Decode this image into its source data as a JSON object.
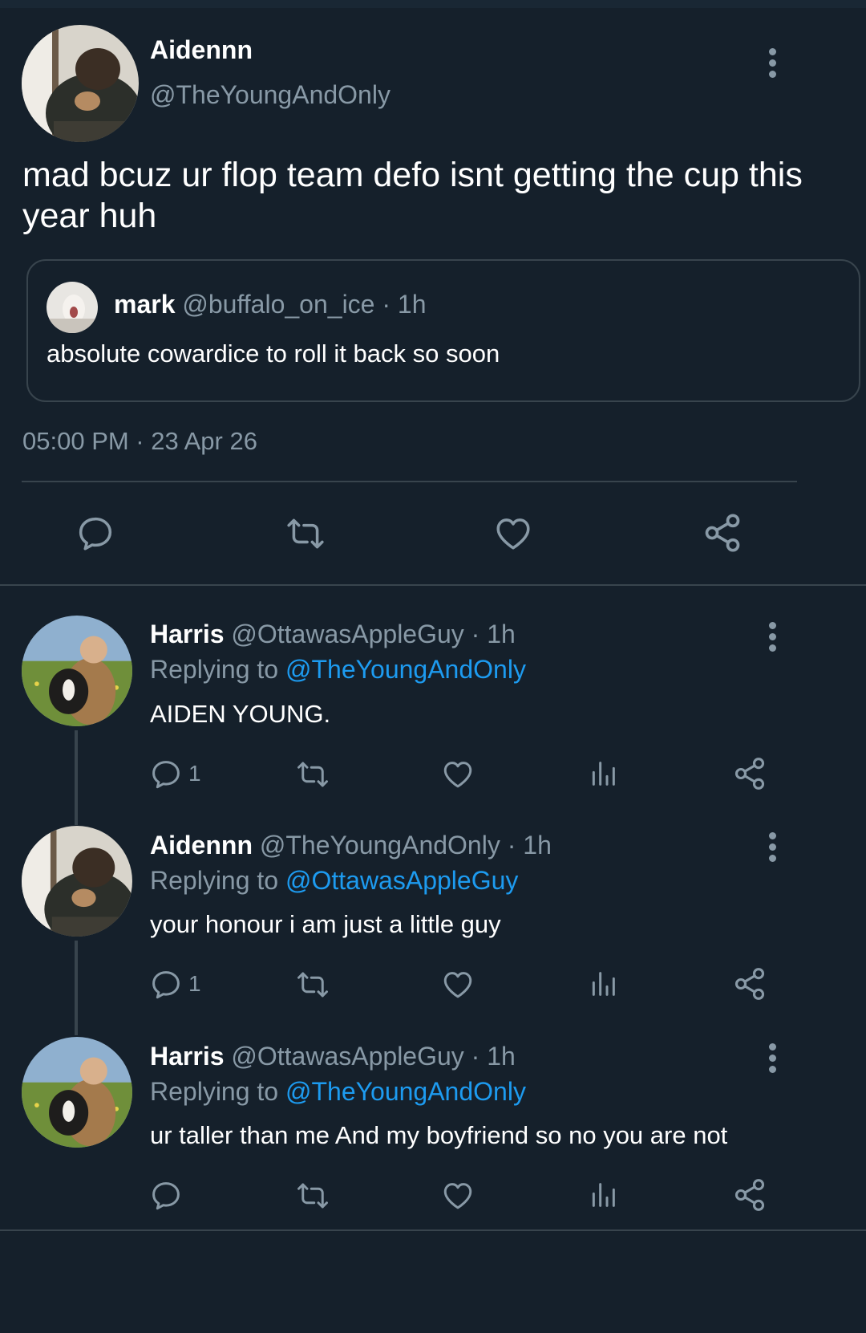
{
  "main_tweet": {
    "author_name": "Aidennn",
    "author_handle": "@TheYoungAndOnly",
    "text_line1": "mad bcuz ur flop team defo isnt getting the cup this",
    "text_line2": "year huh",
    "quoted": {
      "author_name": "mark",
      "author_handle": "@buffalo_on_ice",
      "time": "· 1h",
      "text": "absolute cowardice to roll it back so soon"
    },
    "timestamp": "05:00 PM · 23 Apr 26"
  },
  "replies": [
    {
      "author_name": "Harris",
      "author_handle": "@OttawasAppleGuy",
      "time": "· 1h",
      "replying_prefix": "Replying to",
      "replying_to": "@TheYoungAndOnly",
      "text": "AIDEN YOUNG.",
      "reply_count": "1"
    },
    {
      "author_name": "Aidennn",
      "author_handle": "@TheYoungAndOnly",
      "time": "· 1h",
      "replying_prefix": "Replying to",
      "replying_to": "@OttawasAppleGuy",
      "text": "your honour i am just a little guy",
      "reply_count": "1"
    },
    {
      "author_name": "Harris",
      "author_handle": "@OttawasAppleGuy",
      "time": "· 1h",
      "replying_prefix": "Replying to",
      "replying_to": "@TheYoungAndOnly",
      "text": "ur taller than me And my boyfriend so no you are not",
      "reply_count": ""
    }
  ],
  "colors": {
    "background": "#15202b",
    "muted": "#8899a6",
    "link": "#1d9bf0",
    "divider": "#38444d"
  }
}
